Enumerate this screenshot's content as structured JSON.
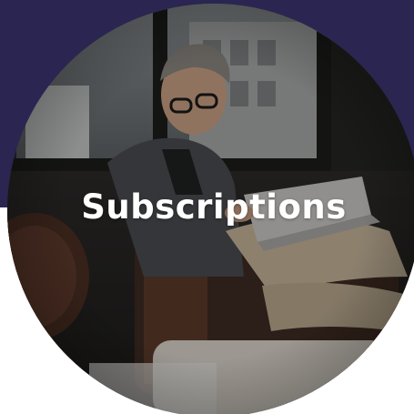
{
  "card": {
    "title": "Subscriptions"
  },
  "colors": {
    "band_top": "#2b2552",
    "band_bottom": "#ffffff",
    "title_text": "#ffffff"
  },
  "image": {
    "subject": "man-reading-laptop-photo"
  }
}
